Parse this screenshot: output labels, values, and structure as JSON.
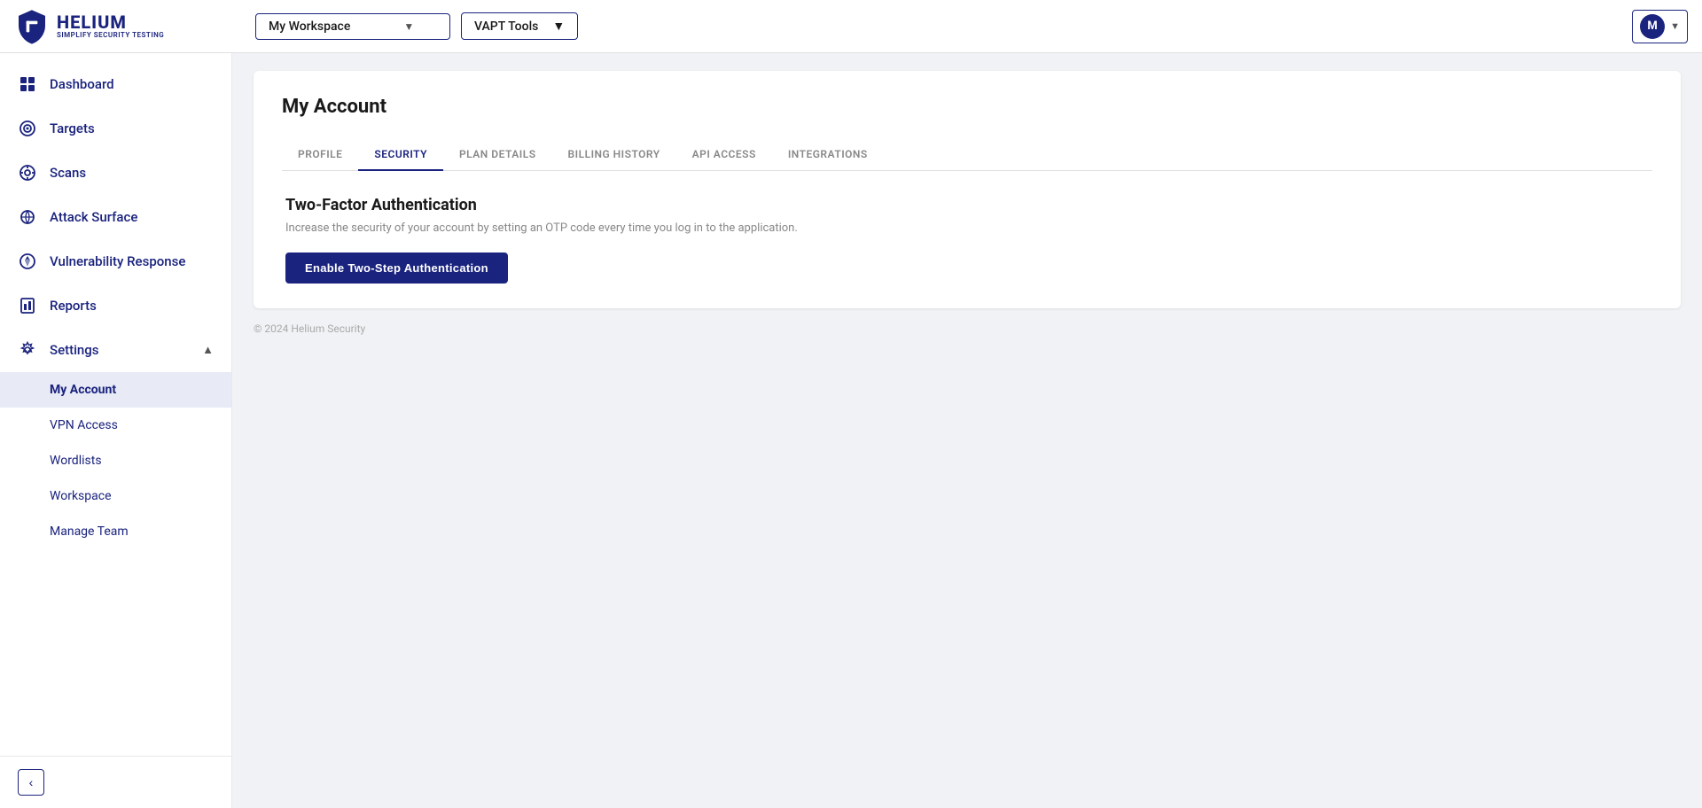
{
  "brand": {
    "name": "HELIUM",
    "tagline": "SIMPLIFY SECURITY TESTING",
    "avatar_letter": "M"
  },
  "topbar": {
    "workspace_label": "My Workspace",
    "workspace_chevron": "▼",
    "vapt_label": "VAPT Tools",
    "vapt_chevron": "▼",
    "user_chevron": "▼"
  },
  "sidebar": {
    "items": [
      {
        "id": "dashboard",
        "label": "Dashboard",
        "icon": "dashboard-icon"
      },
      {
        "id": "targets",
        "label": "Targets",
        "icon": "targets-icon"
      },
      {
        "id": "scans",
        "label": "Scans",
        "icon": "scans-icon"
      },
      {
        "id": "attack-surface",
        "label": "Attack Surface",
        "icon": "attack-surface-icon"
      },
      {
        "id": "vulnerability-response",
        "label": "Vulnerability Response",
        "icon": "vulnerability-icon"
      },
      {
        "id": "reports",
        "label": "Reports",
        "icon": "reports-icon"
      },
      {
        "id": "settings",
        "label": "Settings",
        "icon": "settings-icon",
        "expanded": true,
        "arrow": "▲"
      }
    ],
    "submenu": [
      {
        "id": "my-account",
        "label": "My Account",
        "active": true
      },
      {
        "id": "vpn-access",
        "label": "VPN Access"
      },
      {
        "id": "wordlists",
        "label": "Wordlists"
      },
      {
        "id": "workspace",
        "label": "Workspace"
      },
      {
        "id": "manage-team",
        "label": "Manage Team"
      }
    ],
    "collapse_icon": "‹"
  },
  "page": {
    "title": "My Account",
    "tabs": [
      {
        "id": "profile",
        "label": "PROFILE"
      },
      {
        "id": "security",
        "label": "SECURITY",
        "active": true
      },
      {
        "id": "plan-details",
        "label": "PLAN DETAILS"
      },
      {
        "id": "billing-history",
        "label": "BILLING HISTORY"
      },
      {
        "id": "api-access",
        "label": "API ACCESS"
      },
      {
        "id": "integrations",
        "label": "INTEGRATIONS"
      }
    ],
    "twofa": {
      "title": "Two-Factor Authentication",
      "description": "Increase the security of your account by setting an OTP code every time you log in to the application.",
      "button_label": "Enable Two-Step Authentication"
    },
    "footer": "© 2024 Helium Security"
  }
}
